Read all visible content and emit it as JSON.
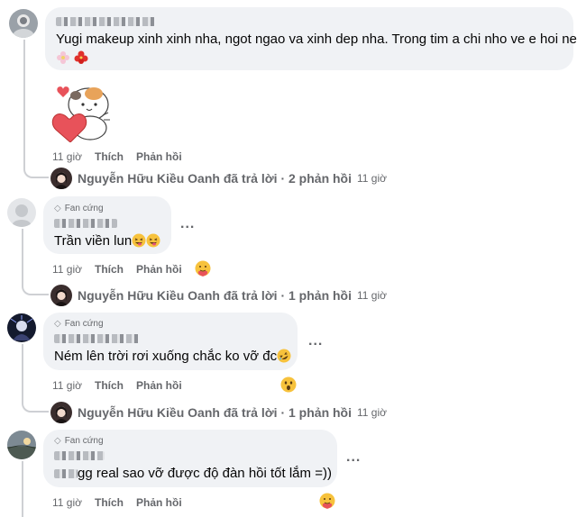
{
  "comments": [
    {
      "author_blurred": true,
      "text": "Yugi makeup xinh xinh nha, ngot ngao va xinh dep nha. Trong tim a chi nho ve e hoi ne",
      "time": "11 giờ",
      "like": "Thích",
      "reply": "Phản hồi",
      "replies_summary": "Nguyễn Hữu Kiều Oanh đã trả lời · 2 phản hồi",
      "replies_time": "11 giờ"
    },
    {
      "badge": "Fan cứng",
      "author_blurred": true,
      "text": "Trần viền lun",
      "time": "11 giờ",
      "like": "Thích",
      "reply": "Phản hồi",
      "more": "...",
      "replies_summary": "Nguyễn Hữu Kiều Oanh đã trả lời · 1 phản hồi",
      "replies_time": "11 giờ"
    },
    {
      "badge": "Fan cứng",
      "author_blurred": true,
      "text": "Ném lên trời rơi xuống chắc ko vỡ đc",
      "time": "11 giờ",
      "like": "Thích",
      "reply": "Phản hồi",
      "more": "...",
      "replies_summary": "Nguyễn Hữu Kiều Oanh đã trả lời · 1 phản hồi",
      "replies_time": "11 giờ"
    },
    {
      "badge": "Fan cứng",
      "author_blurred": true,
      "text": "gg real sao vỡ được độ đàn hồi tốt lắm =))",
      "time": "11 giờ",
      "like": "Thích",
      "reply": "Phản hồi",
      "more": "..."
    }
  ],
  "colors": {
    "bubble": "#f0f2f5",
    "meta": "#65676b",
    "line": "#ced0d4"
  },
  "icons": [
    "flower-icon",
    "hibiscus-icon",
    "cat-heart-sticker",
    "laughing-tongue-icon",
    "rofl-icon",
    "care-reaction-icon",
    "wow-reaction-icon",
    "diamond-badge-icon"
  ]
}
